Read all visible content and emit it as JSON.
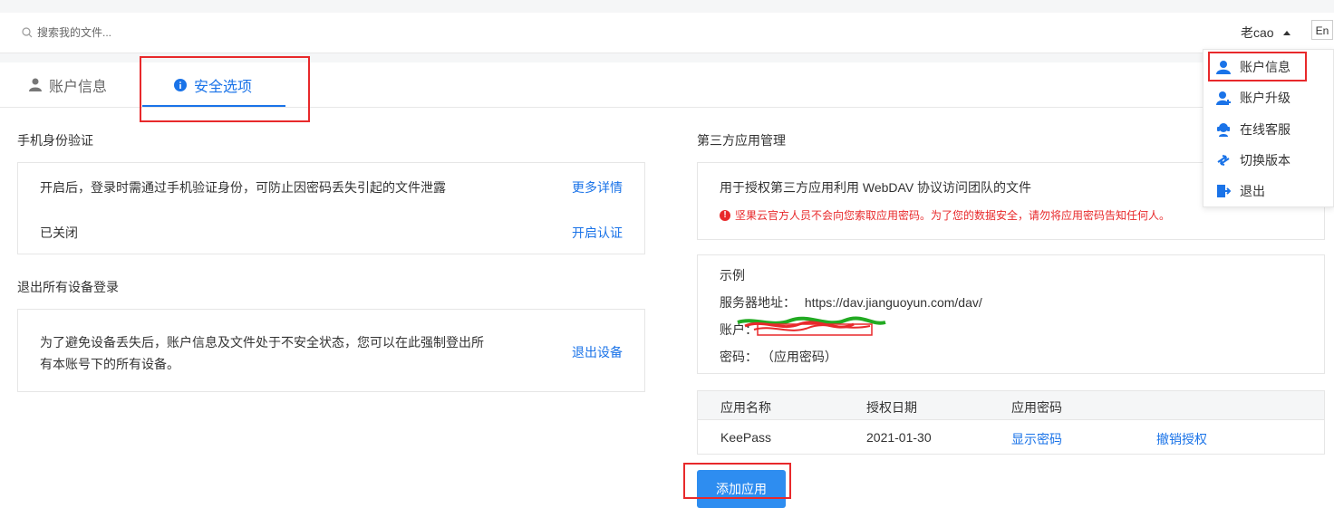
{
  "header": {
    "search_placeholder": "搜索我的文件...",
    "username": "老cao",
    "lang": "En"
  },
  "tabs": [
    {
      "label": "账户信息"
    },
    {
      "label": "安全选项"
    }
  ],
  "phone_verify": {
    "title": "手机身份验证",
    "desc": "开启后，登录时需通过手机验证身份，可防止因密码丢失引起的文件泄露",
    "more_link": "更多详情",
    "status": "已关闭",
    "enable_link": "开启认证"
  },
  "logout_all": {
    "title": "退出所有设备登录",
    "desc_line1": "为了避免设备丢失后，账户信息及文件处于不安全状态，您可以在此强制登出所",
    "desc_line2": "有本账号下的所有设备。",
    "logout_link": "退出设备"
  },
  "third_party": {
    "title": "第三方应用管理",
    "desc": "用于授权第三方应用利用 WebDAV 协议访问团队的文件",
    "warning": "坚果云官方人员不会向您索取应用密码。为了您的数据安全，请勿将应用密码告知任何人。",
    "example_title": "示例",
    "server_label": "服务器地址：",
    "server_url": "https://dav.jianguoyun.com/dav/",
    "account_label": "账户：",
    "password_label": "密码：",
    "password_value": "（应用密码）",
    "table": {
      "headers": [
        "应用名称",
        "授权日期",
        "应用密码"
      ],
      "rows": [
        {
          "name": "KeePass",
          "date": "2021-01-30",
          "show_pwd": "显示密码",
          "revoke": "撤销授权"
        }
      ]
    },
    "add_button": "添加应用"
  },
  "dropdown": {
    "items": [
      {
        "label": "账户信息",
        "icon": "user-icon"
      },
      {
        "label": "账户升级",
        "icon": "user-upgrade-icon"
      },
      {
        "label": "在线客服",
        "icon": "support-icon"
      },
      {
        "label": "切换版本",
        "icon": "switch-icon"
      },
      {
        "label": "退出",
        "icon": "logout-icon"
      }
    ]
  },
  "colors": {
    "accent": "#1a73e8",
    "button": "#2e8df0",
    "warning": "#e8292b",
    "annotation_red": "#e8292b"
  }
}
